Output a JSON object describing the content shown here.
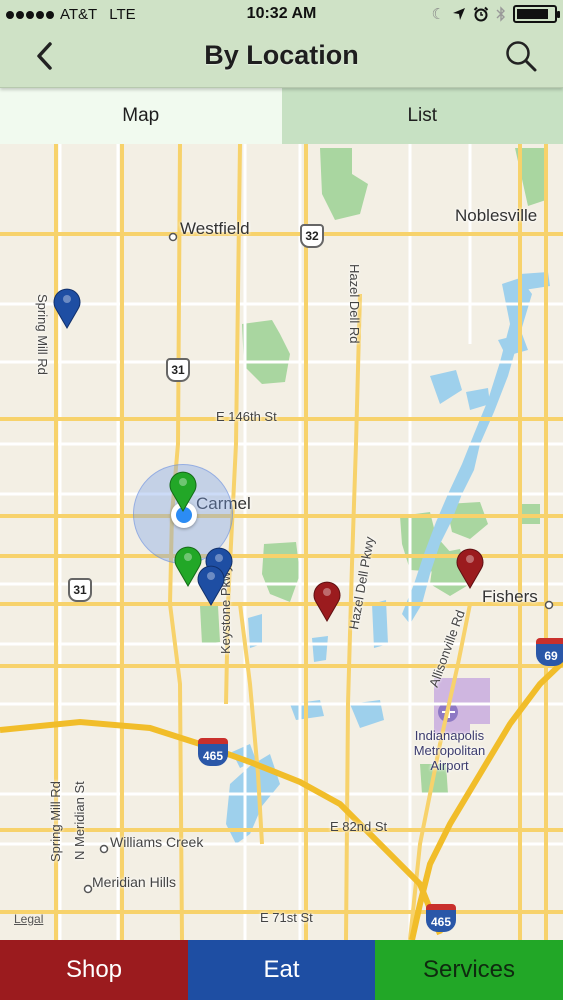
{
  "status_bar": {
    "carrier": "AT&T",
    "network": "LTE",
    "time": "10:32 AM",
    "signal_dots": 5,
    "battery_level": 0.85,
    "icons": [
      "moon-icon",
      "location-arrow-icon",
      "alarm-icon",
      "bluetooth-icon",
      "battery-icon"
    ]
  },
  "header": {
    "title": "By Location",
    "back_icon": "chevron-left-icon",
    "search_icon": "search-icon"
  },
  "tabs": [
    {
      "label": "Map",
      "active": true
    },
    {
      "label": "List",
      "active": false
    }
  ],
  "map": {
    "places": {
      "westfield": "Westfield",
      "noblesville": "Noblesville",
      "carmel": "Carmel",
      "fishers": "Fishers",
      "airport": "Indianapolis Metropolitan Airport",
      "williams_creek": "Williams Creek",
      "meridian_hills": "Meridian Hills"
    },
    "roads": {
      "e146": "E 146th St",
      "e82": "E 82nd St",
      "e71": "E 71st St",
      "hazel_dell_rd": "Hazel Dell Rd",
      "hazel_dell_pkwy": "Hazel Dell Pkwy",
      "spring_mill_top": "Spring Mill Rd",
      "spring_mill_bottom": "Spring Mill Rd",
      "n_meridian": "N Meridian St",
      "keystone": "Keystone Pkwy",
      "allisonville": "Allisonville Rd"
    },
    "shields": {
      "in32": "32",
      "us31_top": "31",
      "us31_bottom": "31",
      "i465_left": "465",
      "i465_right": "465",
      "i69": "69"
    },
    "legal": "Legal",
    "pin_colors": {
      "shop": "#9b1b1e",
      "eat": "#1e4ea3",
      "services": "#22a727"
    },
    "pins": [
      {
        "category": "eat"
      },
      {
        "category": "services"
      },
      {
        "category": "services"
      },
      {
        "category": "eat"
      },
      {
        "category": "eat"
      },
      {
        "category": "shop"
      },
      {
        "category": "shop"
      }
    ]
  },
  "bottom_bar": {
    "shop": "Shop",
    "eat": "Eat",
    "services": "Services",
    "colors": {
      "shop": "#9b1b1e",
      "eat": "#1e4ea3",
      "services": "#22a727"
    }
  }
}
